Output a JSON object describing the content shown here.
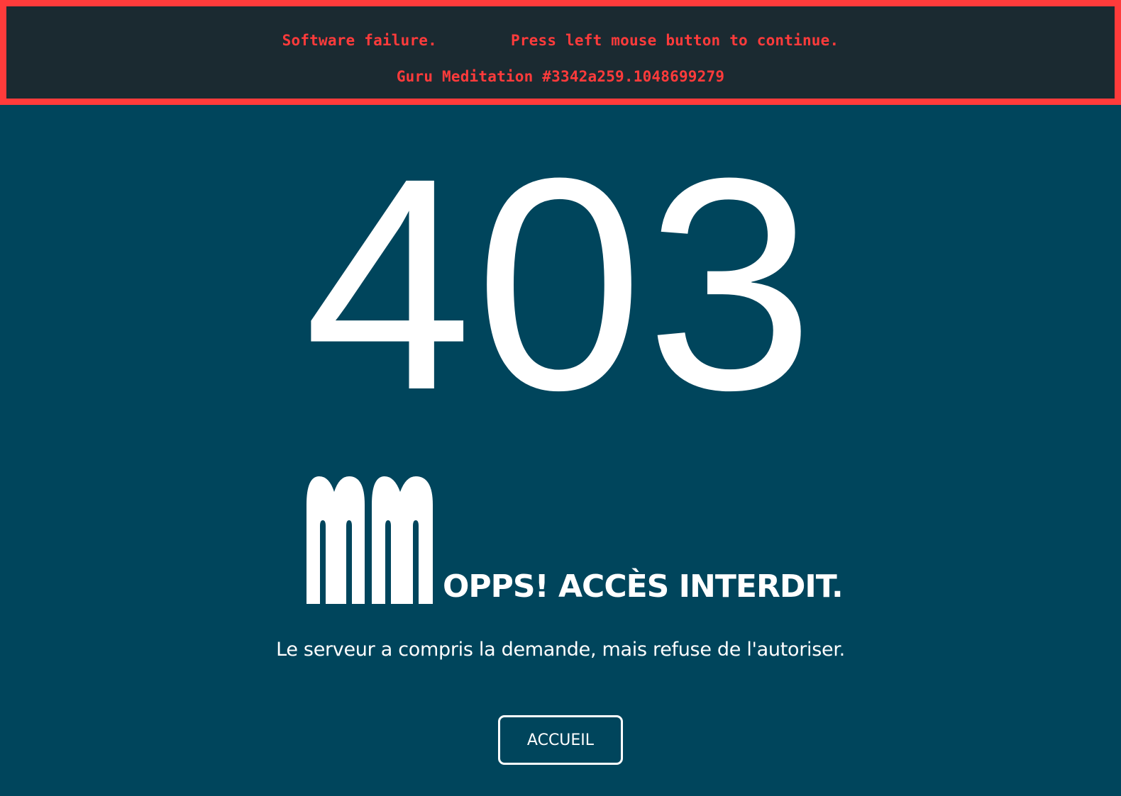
{
  "guru": {
    "message_left": "Software failure.",
    "message_right": "Press left mouse button to continue.",
    "meditation": "Guru Meditation #3342a259.1048699279"
  },
  "error": {
    "code": "403",
    "title": "OPPS! ACCÈS INTERDIT.",
    "description": "Le serveur a compris la demande, mais refuse de l'autoriser."
  },
  "button": {
    "label": "ACCUEIL"
  },
  "colors": {
    "background": "#00455c",
    "guru_background": "#1b2a31",
    "guru_accent": "#ff3b3b",
    "text": "#ffffff"
  },
  "icons": {
    "logo": "mm-logo-icon"
  }
}
